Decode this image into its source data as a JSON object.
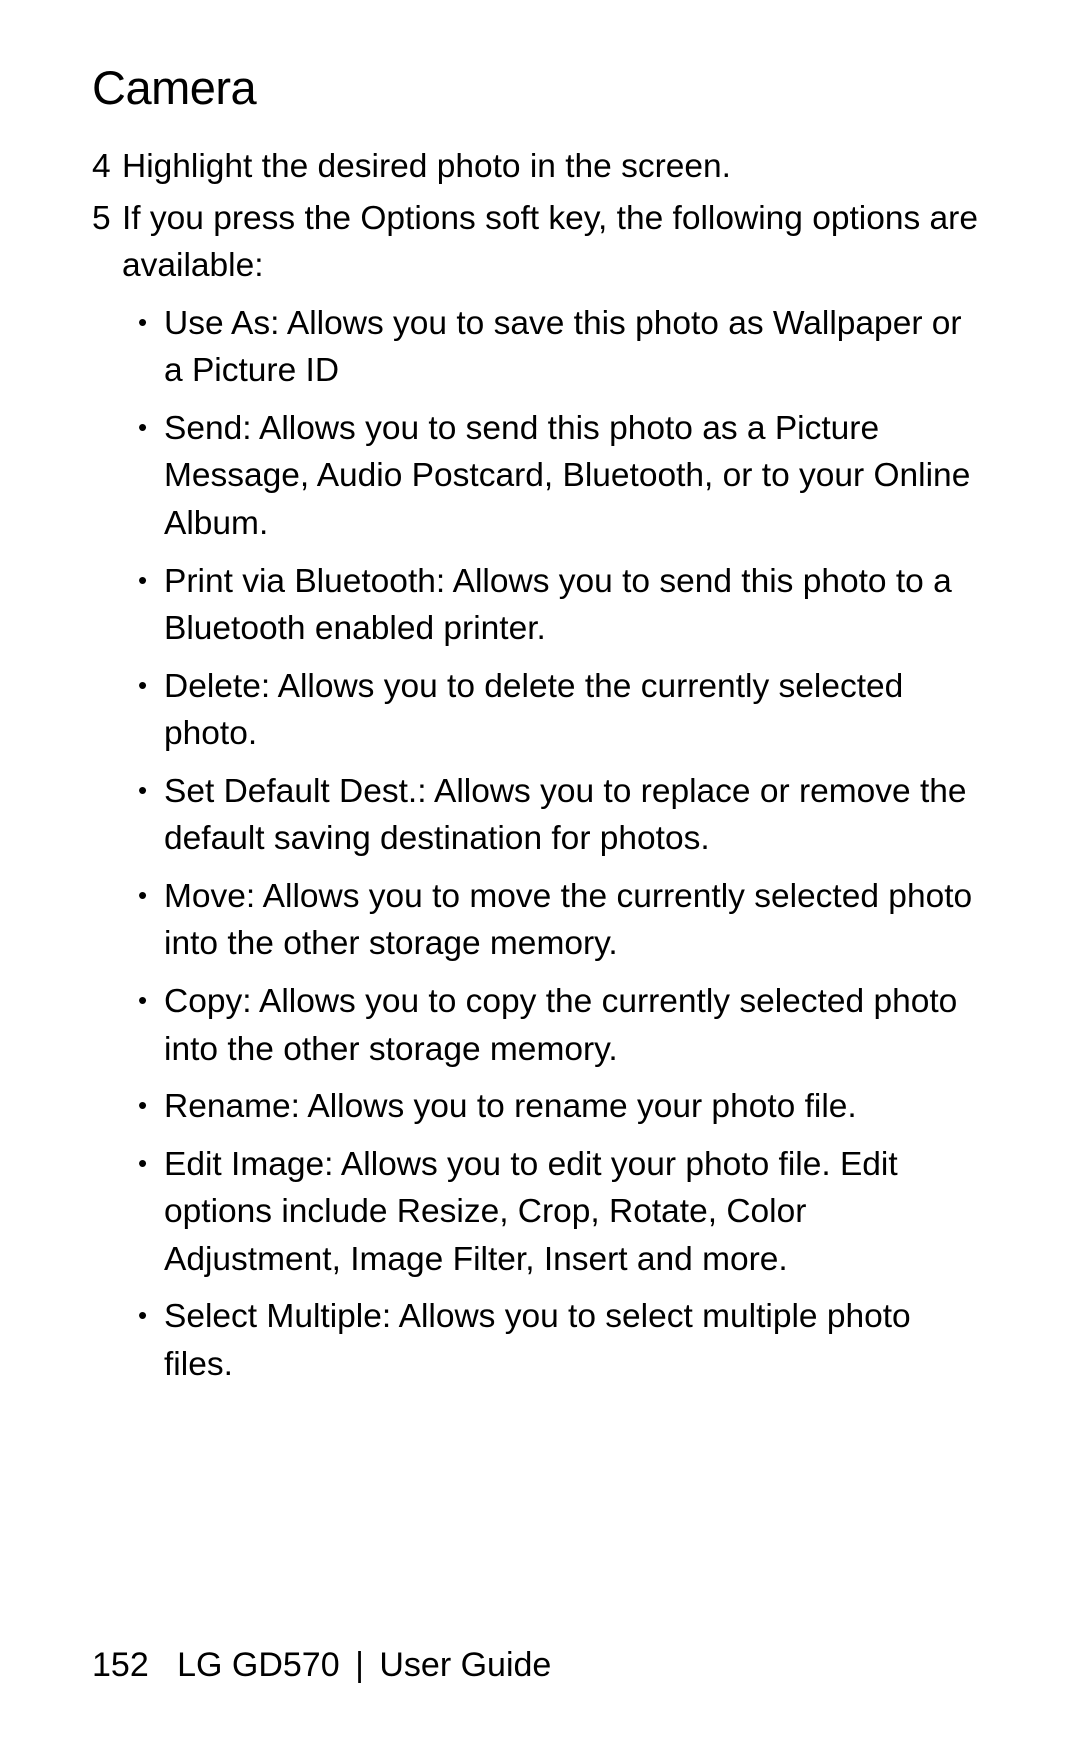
{
  "title": "Camera",
  "steps": [
    {
      "num": "4",
      "text": "Highlight the desired photo in the screen."
    },
    {
      "num": "5",
      "text": "If you press the Options soft key, the following options are available:"
    }
  ],
  "bullets": [
    "Use As: Allows you to save this photo as Wallpaper or a Picture ID",
    "Send: Allows you to send this photo as a Picture Message, Audio Postcard, Bluetooth, or to your Online Album.",
    "Print via Bluetooth: Allows you to send this photo to a Bluetooth enabled printer.",
    "Delete: Allows you to delete the currently selected photo.",
    "Set Default Dest.: Allows you to replace or remove the default saving destination for photos.",
    "Move: Allows you to move the currently selected photo into the other storage memory.",
    "Copy: Allows you to copy the currently selected photo into the other storage memory.",
    "Rename: Allows you to rename your photo file.",
    "Edit Image: Allows you to edit your photo file. Edit options include Resize, Crop, Rotate, Color Adjustment, Image Filter, Insert and more.",
    "Select Multiple: Allows you to select multiple photo files."
  ],
  "footer": {
    "page": "152",
    "device": "LG GD570",
    "separator": "|",
    "doc": "User Guide"
  }
}
